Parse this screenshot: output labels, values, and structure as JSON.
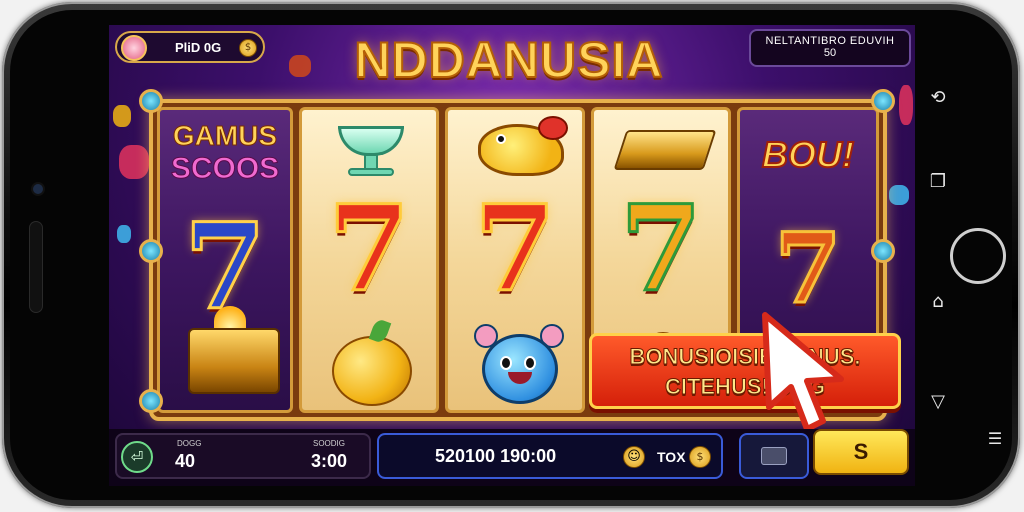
{
  "header": {
    "player_label": "PliD 0G",
    "title": "NDDANUSIA",
    "info_label": "NELTANTIBRO EDUVIH",
    "info_value": "50"
  },
  "reels": {
    "reel1": {
      "top_text_1": "GAMUS",
      "top_text_2": "SCOOS"
    },
    "reel5": {
      "top_text": "BOU!"
    }
  },
  "bonus_banner": {
    "line1": "BONUSIOISIE  JANUS.",
    "line2": "CITEHUS!    OUG"
  },
  "bottom": {
    "left_label_1": "DOGG",
    "left_value_1": "40",
    "left_label_2": "SOODIG",
    "left_value_2": "3:00",
    "balance": "520100 190:00",
    "tax_label": "TOX",
    "spin_label": "S"
  },
  "colors": {
    "accent_gold": "#ffd35a",
    "banner_red": "#d5200a",
    "background_purple": "#3c0f6b",
    "spin_yellow": "#f0b312"
  },
  "icons": {
    "back": "back-arrow-icon",
    "smiley": "smiley-icon",
    "coin": "coin-icon",
    "card": "card-icon",
    "cursor": "hand-cursor-icon"
  }
}
